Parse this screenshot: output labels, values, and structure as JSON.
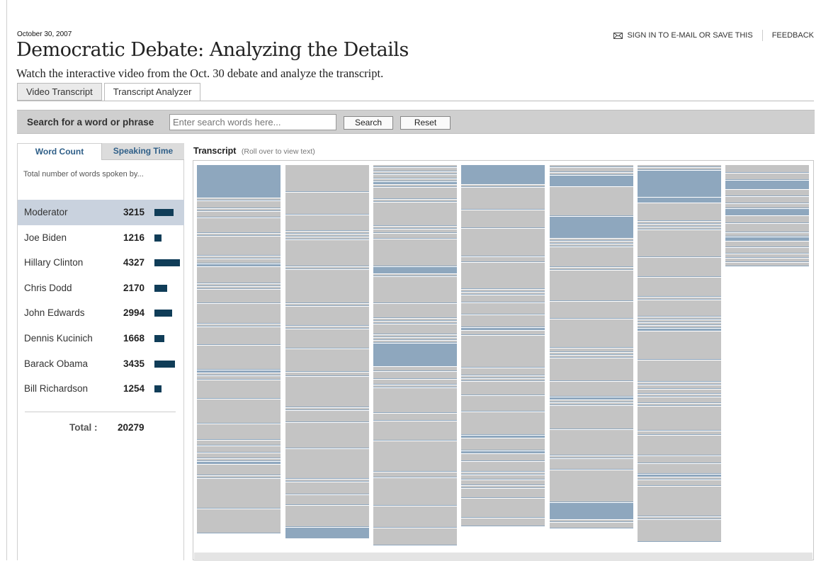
{
  "header": {
    "date": "October 30, 2007",
    "title": "Democratic Debate: Analyzing the Details",
    "subtitle": "Watch the interactive video from the Oct. 30 debate and analyze the transcript.",
    "sign_in": "SIGN IN TO E-MAIL OR SAVE THIS",
    "feedback": "FEEDBACK",
    "sign_in_icon": "envelope-icon"
  },
  "tabs": [
    {
      "label": "Video Transcript",
      "active": false
    },
    {
      "label": "Transcript Analyzer",
      "active": true
    }
  ],
  "search": {
    "label": "Search for a word or phrase",
    "placeholder": "Enter search words here...",
    "value": "",
    "search_button": "Search",
    "reset_button": "Reset"
  },
  "sidebar": {
    "tabs": [
      {
        "label": "Word Count",
        "active": true
      },
      {
        "label": "Speaking Time",
        "active": false
      }
    ],
    "description": "Total number of words spoken by...",
    "speakers": [
      {
        "name": "Moderator",
        "count": "3215",
        "selected": true
      },
      {
        "name": "Joe Biden",
        "count": "1216",
        "selected": false
      },
      {
        "name": "Hillary Clinton",
        "count": "4327",
        "selected": false
      },
      {
        "name": "Chris Dodd",
        "count": "2170",
        "selected": false
      },
      {
        "name": "John Edwards",
        "count": "2994",
        "selected": false
      },
      {
        "name": "Dennis Kucinich",
        "count": "1668",
        "selected": false
      },
      {
        "name": "Barack Obama",
        "count": "3435",
        "selected": false
      },
      {
        "name": "Bill Richardson",
        "count": "1254",
        "selected": false
      }
    ],
    "total_label": "Total :",
    "total_value": "20279"
  },
  "transcript": {
    "title": "Transcript",
    "hint": "(Roll over to view text)"
  },
  "colors": {
    "bar": "#103d58",
    "selected_row": "#c9d2de",
    "segment": "#c4c4c4",
    "highlight": "#8ea7be",
    "divider": "#8ea7be"
  }
}
